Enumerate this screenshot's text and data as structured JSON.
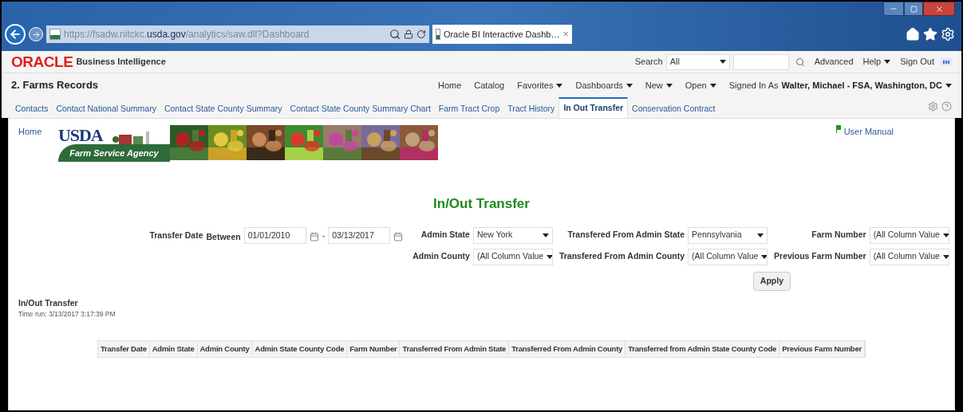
{
  "browser": {
    "address": "https://fsadw.nitckc.**usda.gov**/analytics/saw.dll?Dashboard",
    "tab": {
      "title": "Oracle BI Interactive Dashb…",
      "close": "×"
    }
  },
  "header": {
    "logo": "ORACLE",
    "product": "Business Intelligence",
    "search_label": "Search",
    "search_scope": "All",
    "links": [
      {
        "label": "Advanced",
        "dropdown": false
      },
      {
        "label": "Help",
        "dropdown": true
      },
      {
        "label": "Sign Out",
        "dropdown": false
      }
    ]
  },
  "nav": {
    "title": "2. Farms Records",
    "items": [
      {
        "label": "Home",
        "dropdown": false
      },
      {
        "label": "Catalog",
        "dropdown": false
      },
      {
        "label": "Favorites",
        "dropdown": true
      },
      {
        "label": "Dashboards",
        "dropdown": true
      },
      {
        "label": "New",
        "dropdown": true
      },
      {
        "label": "Open",
        "dropdown": true
      }
    ],
    "signed_in_label": "Signed In As",
    "user": "Walter, Michael - FSA, Washington, DC"
  },
  "tabs": [
    {
      "label": "Contacts",
      "selected": false
    },
    {
      "label": "Contact National Summary",
      "selected": false
    },
    {
      "label": "Contact State County Summary",
      "selected": false
    },
    {
      "label": "Contact State County Summary Chart",
      "selected": false
    },
    {
      "label": "Farm Tract Crop",
      "selected": false
    },
    {
      "label": "Tract History",
      "selected": false
    },
    {
      "label": "In Out Transfer",
      "selected": true
    },
    {
      "label": "Conservation Contract",
      "selected": false
    }
  ],
  "page": {
    "home_link": "Home",
    "user_manual": "User Manual",
    "banner": {
      "agency": "USDA",
      "subtitle": "Farm Service Agency"
    },
    "title": "In/Out Transfer"
  },
  "filters": {
    "date": {
      "label": "Transfer Date",
      "between": "Between",
      "from": "01/01/2010",
      "separator": "-",
      "to": "03/13/2017"
    },
    "selects": [
      {
        "label": "Admin State",
        "value": "New York"
      },
      {
        "label": "Transfered From Admin State",
        "value": "Pennsylvania"
      },
      {
        "label": "Farm Number",
        "value": "(All Column Value"
      },
      {
        "label": "Admin County",
        "value": "(All Column Value"
      },
      {
        "label": "Transfered From Admin County",
        "value": "(All Column Value"
      },
      {
        "label": "Previous Farm Number",
        "value": "(All Column Value"
      }
    ],
    "apply": "Apply"
  },
  "report": {
    "title": "In/Out Transfer",
    "time_run": "Time run: 3/13/2017 3:17:39 PM",
    "table": {
      "columns": [
        "Transfer Date",
        "Admin State",
        "Admin County",
        "Admin State County Code",
        "Farm Number",
        "Transferred From Admin State",
        "Transferred From Admin County",
        "Transferred from Admin State County Code",
        "Previous Farm Number"
      ]
    }
  }
}
